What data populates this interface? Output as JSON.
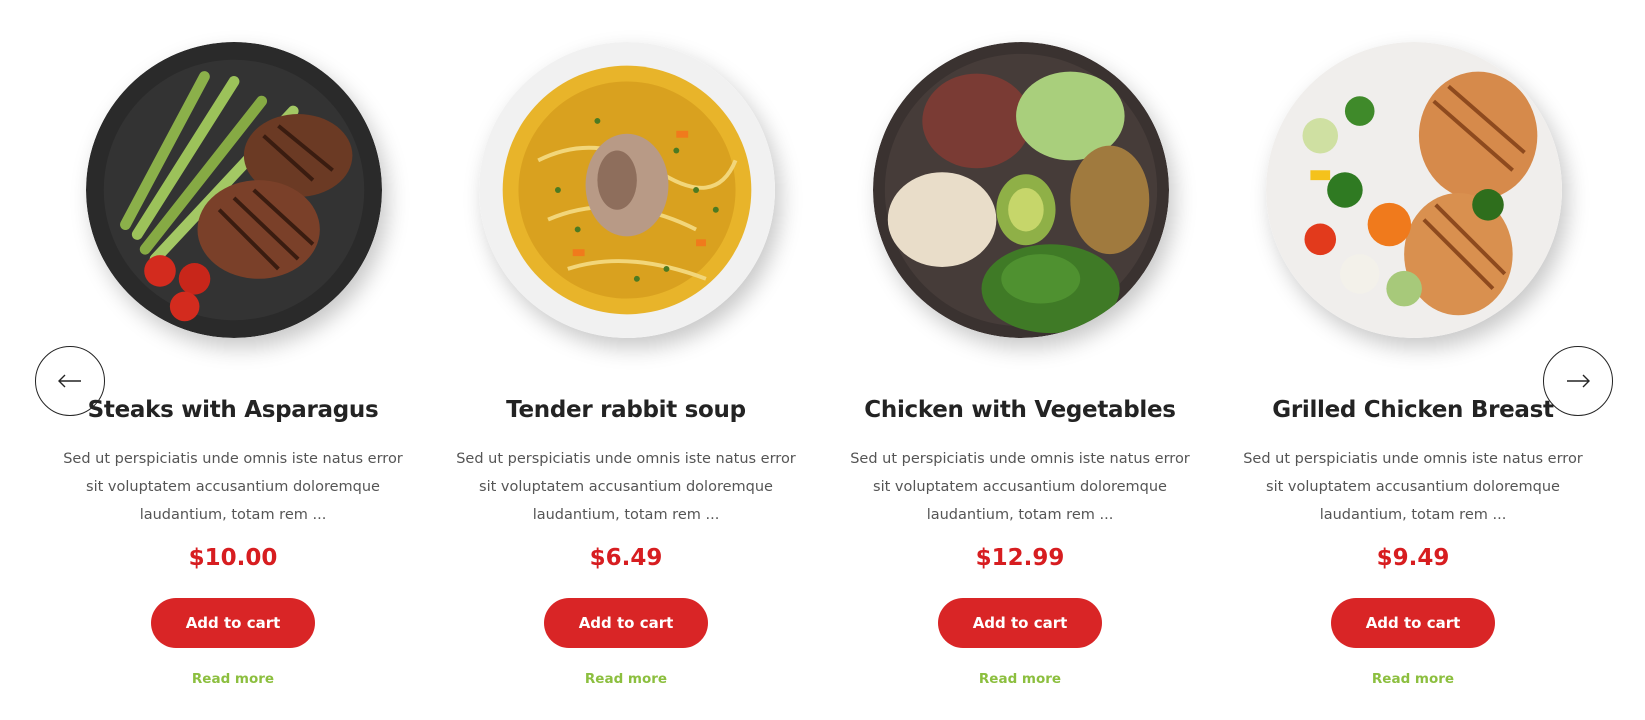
{
  "navigation": {
    "prev_icon": "arrow-left-icon",
    "next_icon": "arrow-right-icon"
  },
  "colors": {
    "price": "#d71d20",
    "button": "#d92526",
    "read_more": "#8cbf3f",
    "title": "#232323"
  },
  "products": [
    {
      "image": "steak-asparagus-plate",
      "title": "Steaks with Asparagus",
      "description": "Sed ut perspiciatis unde omnis iste natus error sit voluptatem accusantium doloremque laudantium, totam rem ...",
      "price": "$10.00",
      "cart_label": "Add to cart",
      "read_more_label": "Read more"
    },
    {
      "image": "rabbit-soup-bowl",
      "title": "Tender rabbit soup",
      "description": "Sed ut perspiciatis unde omnis iste natus error sit voluptatem accusantium doloremque laudantium, totam rem ...",
      "price": "$6.49",
      "cart_label": "Add to cart",
      "read_more_label": "Read more"
    },
    {
      "image": "chicken-vegetables-bowl",
      "title": "Chicken with Vegetables",
      "description": "Sed ut perspiciatis unde omnis iste natus error sit voluptatem accusantium doloremque laudantium, totam rem ...",
      "price": "$12.99",
      "cart_label": "Add to cart",
      "read_more_label": "Read more"
    },
    {
      "image": "grilled-chicken-plate",
      "title": "Grilled Chicken Breast",
      "description": "Sed ut perspiciatis unde omnis iste natus error sit voluptatem accusantium doloremque laudantium, totam rem ...",
      "price": "$9.49",
      "cart_label": "Add to cart",
      "read_more_label": "Read more"
    }
  ]
}
